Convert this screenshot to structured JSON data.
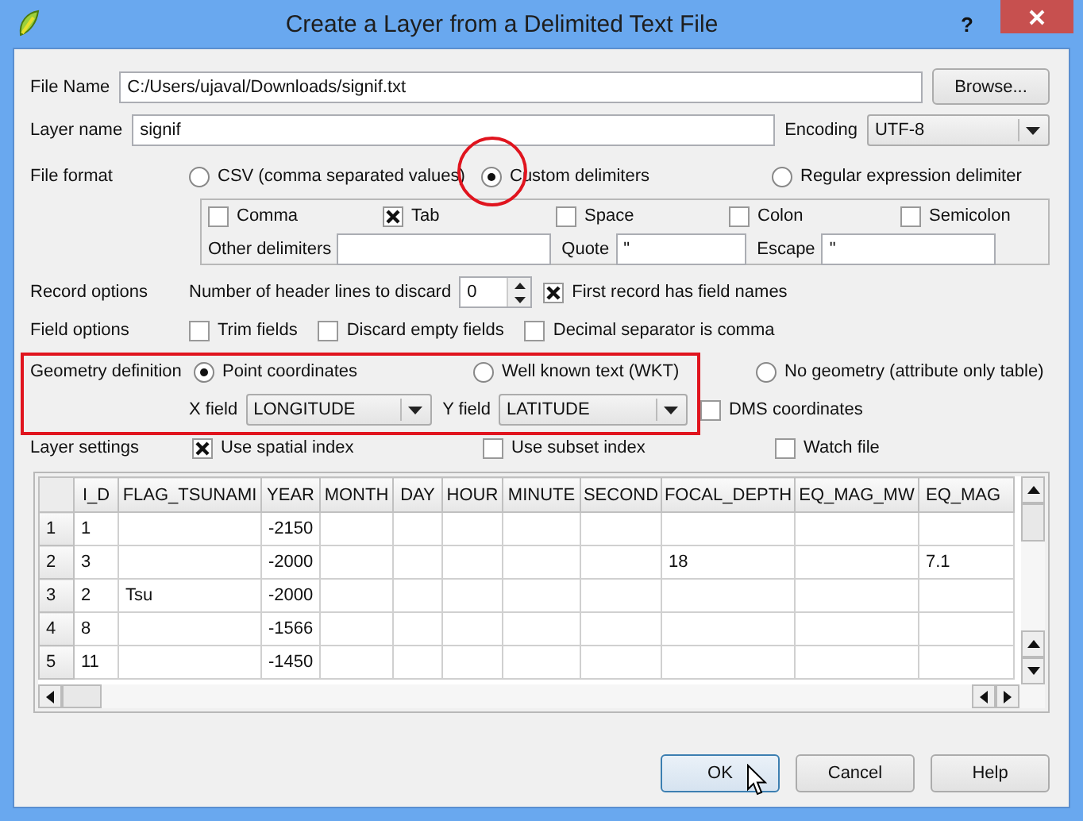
{
  "window": {
    "title": "Create a Layer from a Delimited Text File",
    "help": "?"
  },
  "file_name": {
    "label": "File Name",
    "value": "C:/Users/ujaval/Downloads/signif.txt",
    "button": "Browse..."
  },
  "layer_name": {
    "label": "Layer name",
    "value": "signif"
  },
  "encoding": {
    "label": "Encoding",
    "value": "UTF-8"
  },
  "file_format": {
    "label": "File format",
    "options": [
      {
        "label": "CSV (comma separated values)",
        "selected": false
      },
      {
        "label": "Custom delimiters",
        "selected": true
      },
      {
        "label": "Regular expression delimiter",
        "selected": false
      }
    ]
  },
  "delimiters": {
    "checkboxes": [
      {
        "label": "Comma",
        "checked": false
      },
      {
        "label": "Tab",
        "checked": true
      },
      {
        "label": "Space",
        "checked": false
      },
      {
        "label": "Colon",
        "checked": false
      },
      {
        "label": "Semicolon",
        "checked": false
      }
    ],
    "other": {
      "label": "Other delimiters"
    },
    "quote": {
      "label": "Quote",
      "value": "\""
    },
    "escape": {
      "label": "Escape",
      "value": "\""
    }
  },
  "record_options": {
    "label": "Record options",
    "header_lines_label": "Number of header lines to discard",
    "header_lines_value": "0",
    "first_record": {
      "label": "First record has field names",
      "checked": true
    }
  },
  "field_options": {
    "label": "Field options",
    "checkboxes": [
      {
        "label": "Trim fields",
        "checked": false
      },
      {
        "label": "Discard empty fields",
        "checked": false
      },
      {
        "label": "Decimal separator is comma",
        "checked": false
      }
    ]
  },
  "geometry": {
    "label": "Geometry definition",
    "options": [
      {
        "label": "Point coordinates",
        "selected": true
      },
      {
        "label": "Well known text (WKT)",
        "selected": false
      },
      {
        "label": "No geometry (attribute only table)",
        "selected": false
      }
    ],
    "x_field": {
      "label": "X field",
      "value": "LONGITUDE"
    },
    "y_field": {
      "label": "Y field",
      "value": "LATITUDE"
    },
    "dms": {
      "label": "DMS coordinates",
      "checked": false
    }
  },
  "layer_settings": {
    "label": "Layer settings",
    "checkboxes": [
      {
        "label": "Use spatial index",
        "checked": true
      },
      {
        "label": "Use subset index",
        "checked": false
      },
      {
        "label": "Watch file",
        "checked": false
      }
    ]
  },
  "table": {
    "columns": [
      "I_D",
      "FLAG_TSUNAMI",
      "YEAR",
      "MONTH",
      "DAY",
      "HOUR",
      "MINUTE",
      "SECOND",
      "FOCAL_DEPTH",
      "EQ_MAG_MW",
      "EQ_MAG"
    ],
    "rows": [
      {
        "number": "1",
        "cells": [
          "1",
          null,
          "-2150",
          null,
          null,
          null,
          null,
          null,
          null,
          null,
          null
        ]
      },
      {
        "number": "2",
        "cells": [
          "3",
          null,
          "-2000",
          null,
          null,
          null,
          null,
          null,
          "18",
          null,
          "7.1"
        ]
      },
      {
        "number": "3",
        "cells": [
          "2",
          "Tsu",
          "-2000",
          null,
          null,
          null,
          null,
          null,
          null,
          null,
          null
        ]
      },
      {
        "number": "4",
        "cells": [
          "8",
          null,
          "-1566",
          null,
          null,
          null,
          null,
          null,
          null,
          null,
          null
        ]
      },
      {
        "number": "5",
        "cells": [
          "11",
          null,
          "-1450",
          null,
          null,
          null,
          null,
          null,
          null,
          null,
          null
        ]
      }
    ]
  },
  "buttons": [
    {
      "label": "OK",
      "focused": true
    },
    {
      "label": "Cancel",
      "focused": false
    },
    {
      "label": "Help",
      "focused": false
    }
  ]
}
